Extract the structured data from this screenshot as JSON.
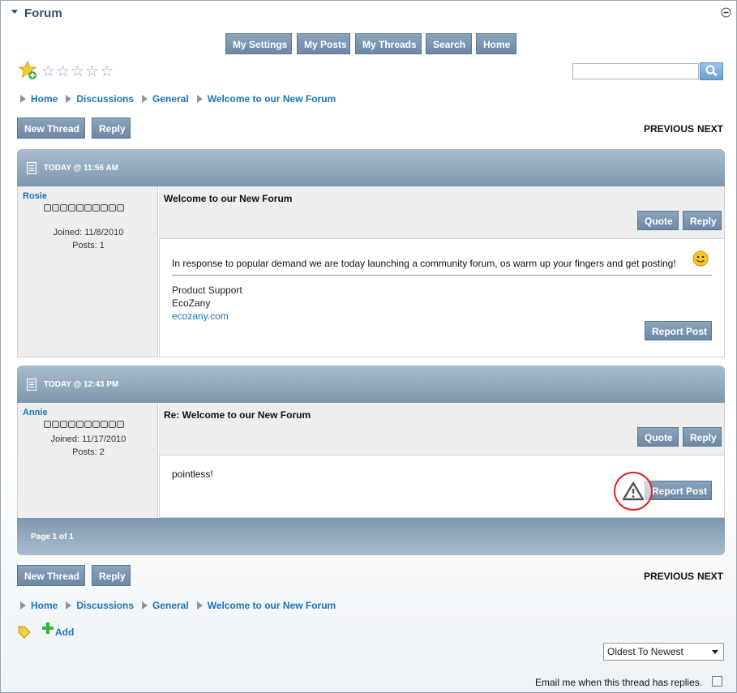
{
  "header": {
    "title": "Forum",
    "collapse_icon": "minus-circle-icon"
  },
  "nav_buttons": [
    "My Settings",
    "My Posts",
    "My Threads",
    "Search",
    "Home"
  ],
  "rating": {
    "icon": "add-rating-star-icon",
    "stars_filled": 0,
    "stars_total": 5
  },
  "search": {
    "value": "",
    "button_icon": "search-icon"
  },
  "breadcrumb": [
    "Home",
    "Discussions",
    "General",
    "Welcome to our New Forum"
  ],
  "toolbar": {
    "new_thread": "New Thread",
    "reply": "Reply",
    "previous": "PREVIOUS",
    "next": "NEXT"
  },
  "posts": [
    {
      "timestamp": "TODAY @ 11:56 AM",
      "author": "Rosie",
      "joined": "Joined: 11/8/2010",
      "posts": "Posts: 1",
      "title": "Welcome to our New Forum",
      "quote": "Quote",
      "reply": "Reply",
      "body": "In response to popular demand we are today launching a community forum, os warm up your fingers and get posting!",
      "signature": [
        "Product Support",
        "EcoZany"
      ],
      "signature_link": "ecozany.com",
      "report": "Report Post"
    },
    {
      "timestamp": "TODAY @ 12:43 PM",
      "author": "Annie",
      "joined": "Joined: 11/17/2010",
      "posts": "Posts: 2",
      "title": "Re: Welcome to our New Forum",
      "quote": "Quote",
      "reply": "Reply",
      "body": "pointless!",
      "report": "Report Post"
    }
  ],
  "pagination": "Page 1 of 1",
  "tags": {
    "icon": "tag-icon",
    "add_label": "Add"
  },
  "sort": {
    "selected": "Oldest To Newest"
  },
  "email_notify": {
    "label": "Email me when this thread has replies.",
    "checked": false
  },
  "colors": {
    "accent": "#1a74b8",
    "button": "#7b95af",
    "header_bar": "#8fa6bc",
    "highlight": "#e02020"
  }
}
